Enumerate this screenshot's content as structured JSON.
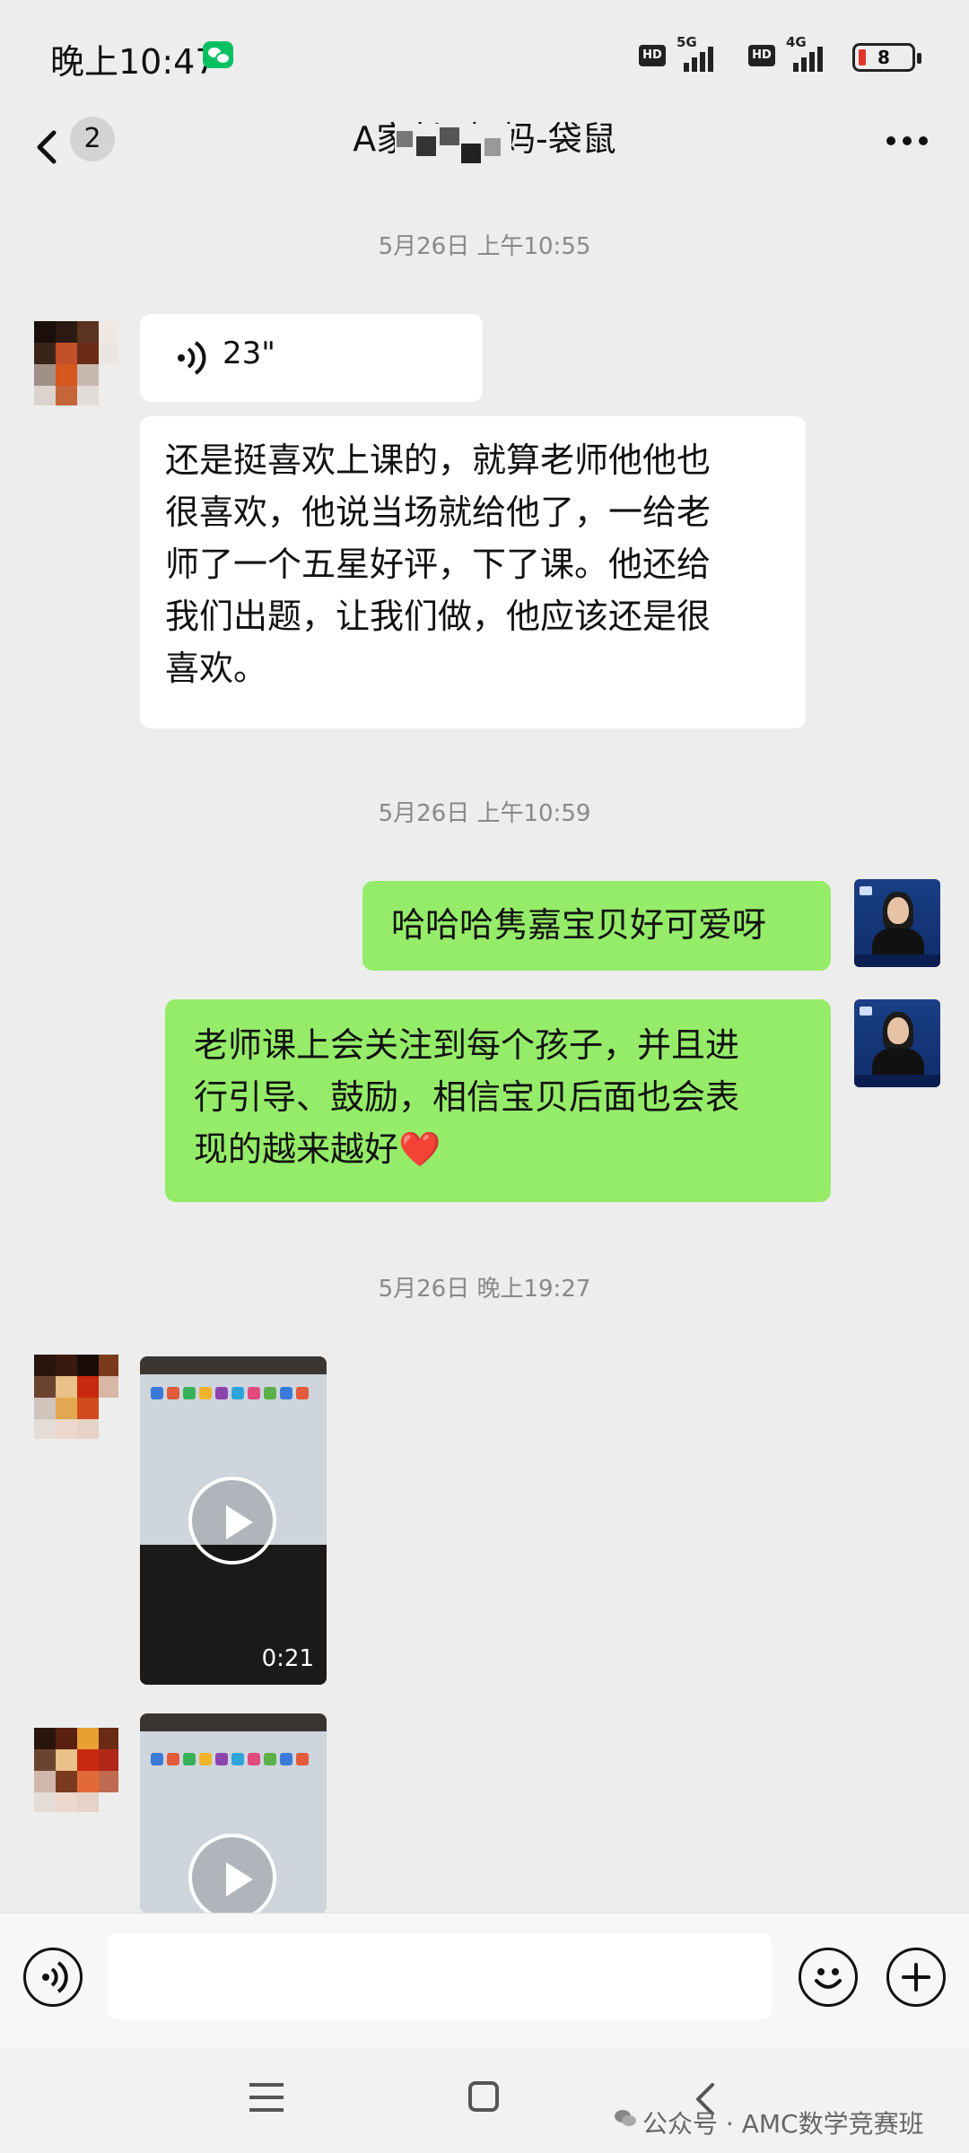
{
  "status_bar": {
    "time": "晚上10:47",
    "sim1_label": "HD",
    "sim1_network": "5G",
    "sim2_label": "HD",
    "sim2_network": "4G",
    "battery": "8"
  },
  "header": {
    "unread_count": "2",
    "title": "A家长-    妈妈-袋鼠"
  },
  "messages": [
    {
      "type": "timestamp",
      "text": "5月26日 上午10:55"
    },
    {
      "type": "voice",
      "side": "in",
      "duration": "23\""
    },
    {
      "type": "text",
      "side": "in",
      "lines": [
        "还是挺喜欢上课的，就算老师他他也",
        "很喜欢，他说当场就给他了，一给老",
        "师了一个五星好评，下了课。他还给",
        "我们出题，让我们做，他应该还是很",
        "喜欢。"
      ]
    },
    {
      "type": "timestamp",
      "text": "5月26日 上午10:59"
    },
    {
      "type": "text",
      "side": "out",
      "lines": [
        "哈哈哈隽嘉宝贝好可爱呀"
      ]
    },
    {
      "type": "text",
      "side": "out",
      "lines": [
        "老师课上会关注到每个孩子，并且进",
        "行引导、鼓励，相信宝贝后面也会表",
        "现的越来越好❤️"
      ]
    },
    {
      "type": "timestamp",
      "text": "5月26日 晚上19:27"
    },
    {
      "type": "video",
      "side": "in",
      "duration": "0:21"
    },
    {
      "type": "video",
      "side": "in",
      "duration": ""
    }
  ],
  "watermark": "公众号 · AMC数学竞赛班",
  "colors": {
    "background": "#ededed",
    "outgoing_bubble": "#95ec69",
    "incoming_bubble": "#ffffff",
    "wechat_green": "#07c160"
  },
  "icons": [
    "back-chevron-icon",
    "more-icon",
    "voice-input-icon",
    "emoji-icon",
    "plus-icon",
    "play-icon",
    "nav-menu-icon",
    "nav-home-icon",
    "nav-back-icon"
  ]
}
